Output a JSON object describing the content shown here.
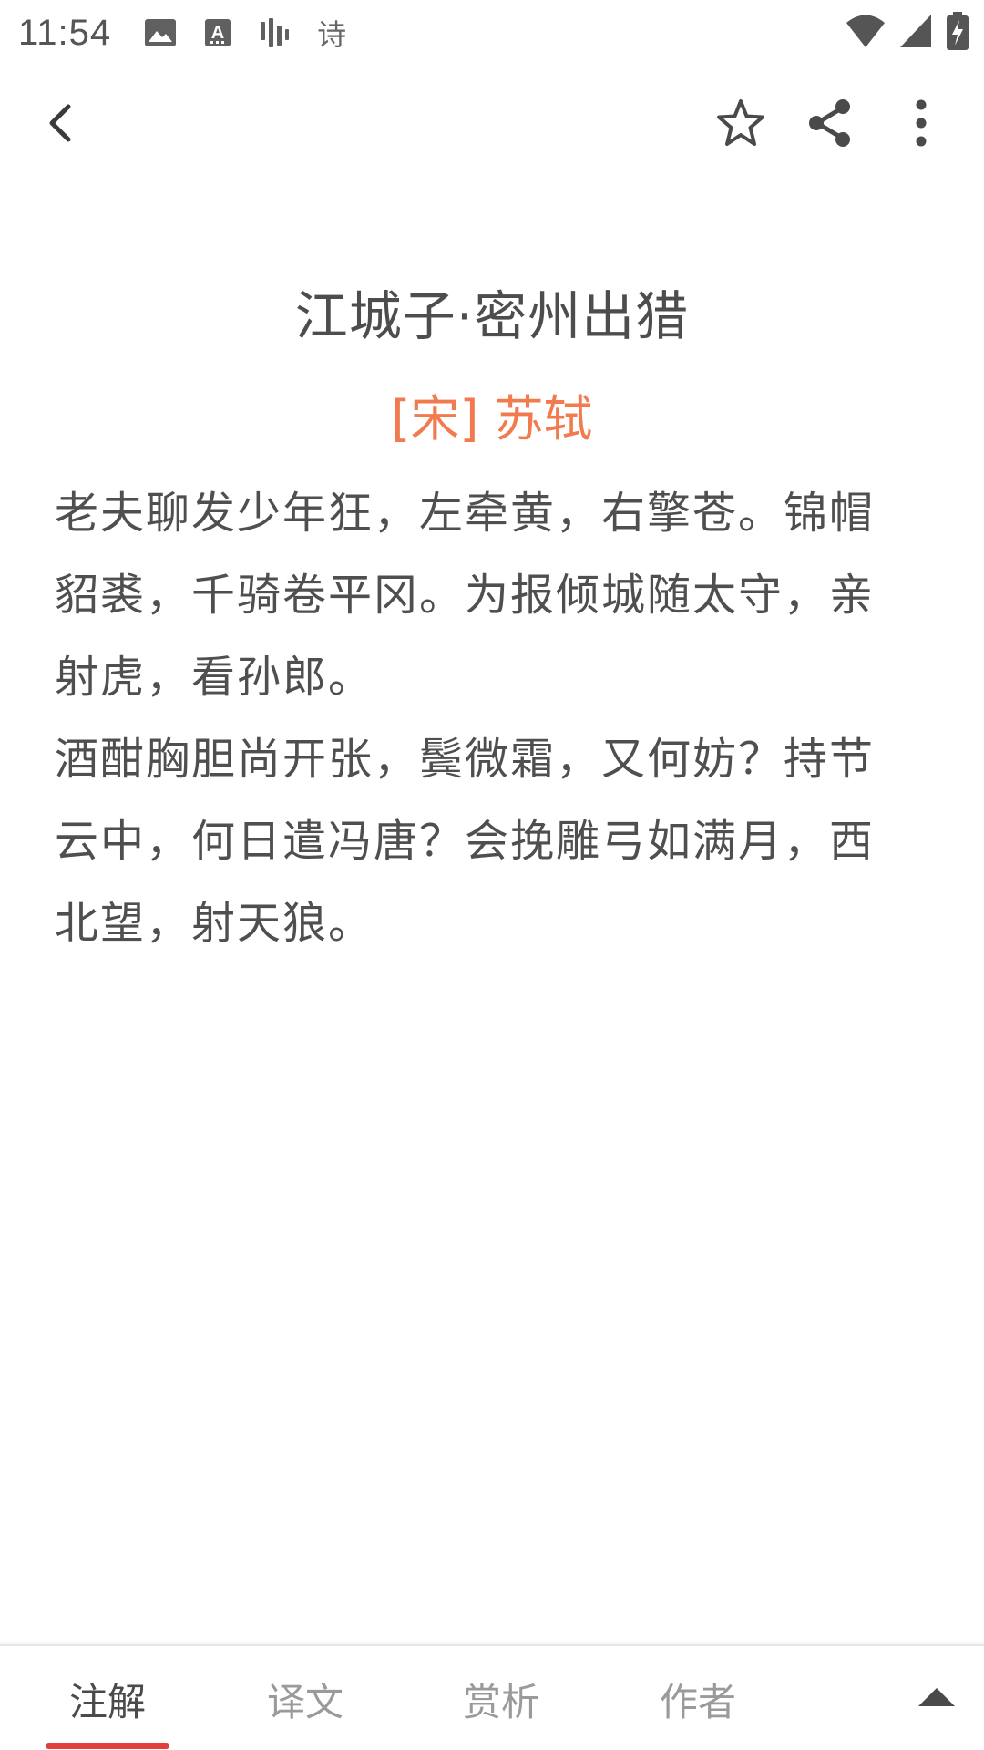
{
  "status_bar": {
    "time": "11:54",
    "app_label": "诗",
    "icons": [
      "image-icon",
      "text-a-icon",
      "audio-bars-icon",
      "wifi-icon",
      "cell-signal-icon",
      "battery-charging-icon"
    ]
  },
  "app_bar": {
    "icons": [
      "back-arrow-icon",
      "star-outline-icon",
      "share-icon",
      "more-vert-icon"
    ]
  },
  "poem": {
    "title": "江城子·密州出猎",
    "author": "[宋] 苏轼",
    "lines": [
      "老夫聊发少年狂，左牵黄，右擎苍。锦帽貂裘，千骑卷平冈。为报倾城随太守，亲射虎，看孙郎。",
      "酒酣胸胆尚开张，鬓微霜，又何妨？持节云中，何日遣冯唐？会挽雕弓如满月，西北望，射天狼。"
    ]
  },
  "tabs": [
    {
      "label": "注解",
      "active": true
    },
    {
      "label": "译文",
      "active": false
    },
    {
      "label": "赏析",
      "active": false
    },
    {
      "label": "作者",
      "active": false
    }
  ],
  "expand_icon": "caret-up-icon",
  "colors": {
    "author": "#f27a4f",
    "active_indicator": "#e2403c",
    "text": "#4f4f4f",
    "inactive_tab": "#9a9a9a"
  }
}
